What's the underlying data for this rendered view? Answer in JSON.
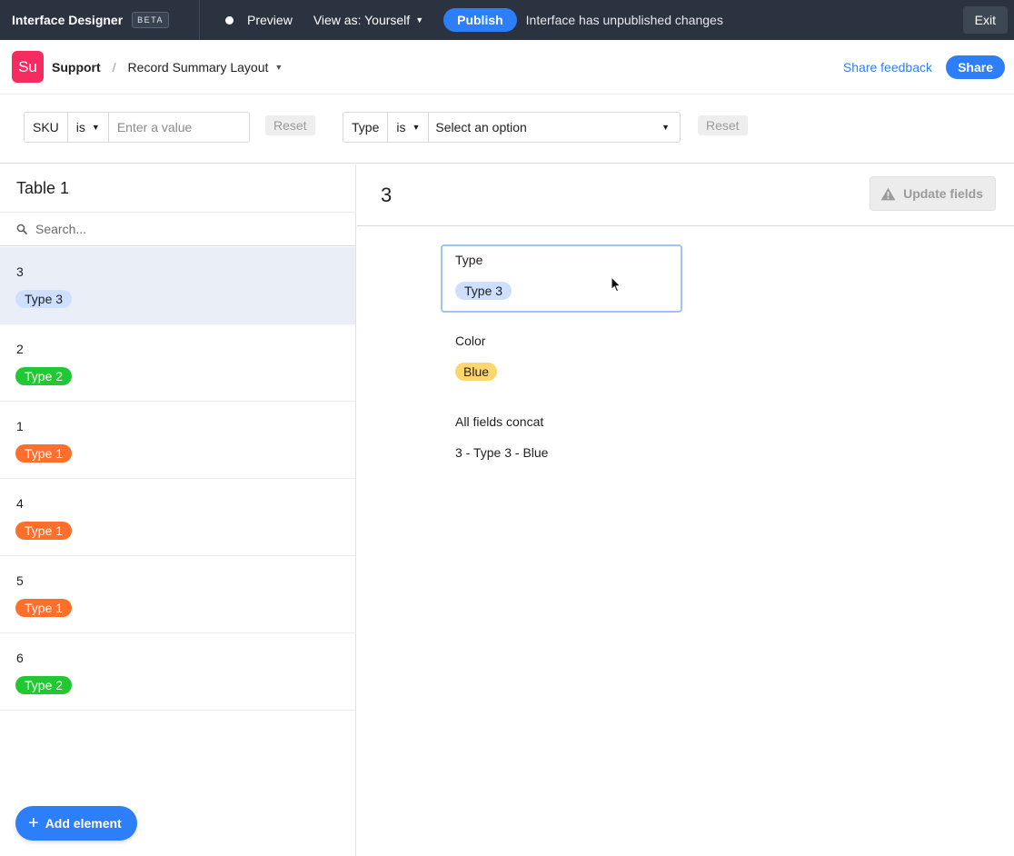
{
  "topbar": {
    "title": "Interface Designer",
    "badge": "BETA",
    "preview": "Preview",
    "view_as": "View as: Yourself",
    "publish": "Publish",
    "status": "Interface has unpublished changes",
    "exit": "Exit"
  },
  "header": {
    "app_initials": "Su",
    "app_name": "Support",
    "separator": "/",
    "page_name": "Record Summary Layout",
    "share_feedback": "Share feedback",
    "share": "Share"
  },
  "filters": [
    {
      "field": "SKU",
      "operator": "is",
      "placeholder": "Enter a value",
      "reset": "Reset"
    },
    {
      "field": "Type",
      "operator": "is",
      "placeholder": "Select an option",
      "reset": "Reset"
    }
  ],
  "left_panel": {
    "title": "Table 1",
    "search_placeholder": "Search...",
    "records": [
      {
        "id": "3",
        "type": "Type 3"
      },
      {
        "id": "2",
        "type": "Type 2"
      },
      {
        "id": "1",
        "type": "Type 1"
      },
      {
        "id": "4",
        "type": "Type 1"
      },
      {
        "id": "5",
        "type": "Type 1"
      },
      {
        "id": "6",
        "type": "Type 2"
      }
    ],
    "add_element": "Add element"
  },
  "detail": {
    "title": "3",
    "update_fields": "Update fields",
    "fields": [
      {
        "label": "Type",
        "value": "Type 3"
      },
      {
        "label": "Color",
        "value": "Blue"
      },
      {
        "label": "All fields concat",
        "value": "3 - Type 3 - Blue"
      }
    ]
  },
  "colors": {
    "topbar_bg": "#2b3340",
    "accent": "#2d7ff9",
    "app_icon": "#f82b60",
    "type_3_bg": "#cfdfff",
    "type_2_bg": "#20c933",
    "type_1_bg": "#ff6f2c",
    "blue_option_bg": "#ffd66e",
    "selected_row_bg": "#eaeef6"
  }
}
